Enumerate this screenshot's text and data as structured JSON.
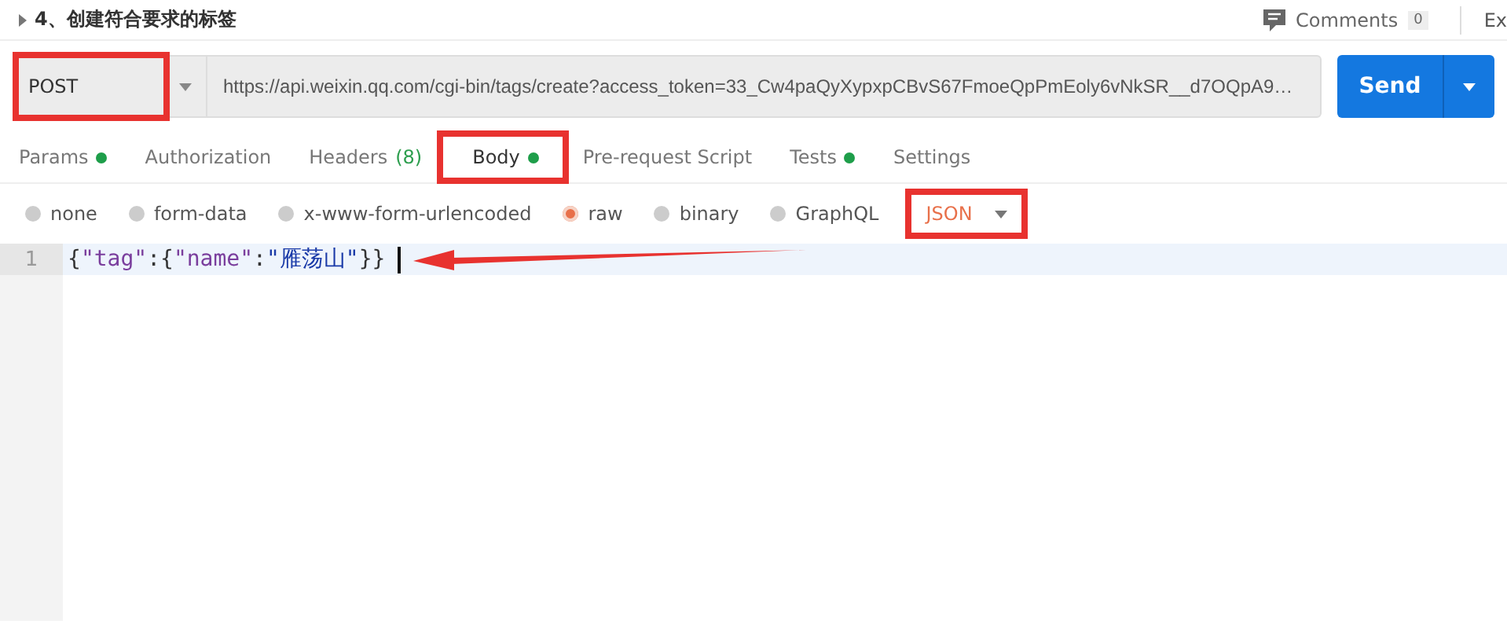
{
  "request": {
    "title": "4、创建符合要求的标签",
    "comments_label": "Comments",
    "comments_count": "0",
    "cut_tab": "Ex"
  },
  "url_bar": {
    "method": "POST",
    "method_highlighted": true,
    "url": "https://api.weixin.qq.com/cgi-bin/tags/create?access_token=33_Cw4paQyXypxpCBvS67FmoeQpPmEoly6vNkSR__d7OQpA9…",
    "send": "Send"
  },
  "tabs": [
    {
      "label": "Params",
      "dot": true,
      "selected": false,
      "highlighted": false
    },
    {
      "label": "Authorization",
      "dot": false,
      "selected": false,
      "highlighted": false
    },
    {
      "label": "Headers",
      "count": "(8)",
      "dot": false,
      "selected": false,
      "highlighted": false
    },
    {
      "label": "Body",
      "dot": true,
      "selected": true,
      "highlighted": true
    },
    {
      "label": "Pre-request Script",
      "dot": false,
      "selected": false,
      "highlighted": false
    },
    {
      "label": "Tests",
      "dot": true,
      "selected": false,
      "highlighted": false
    },
    {
      "label": "Settings",
      "dot": false,
      "selected": false,
      "highlighted": false
    }
  ],
  "body_types": [
    {
      "label": "none",
      "selected": false
    },
    {
      "label": "form-data",
      "selected": false
    },
    {
      "label": "x-www-form-urlencoded",
      "selected": false
    },
    {
      "label": "raw",
      "selected": true
    },
    {
      "label": "binary",
      "selected": false
    },
    {
      "label": "GraphQL",
      "selected": false
    }
  ],
  "format": {
    "label": "JSON",
    "highlighted": true
  },
  "editor": {
    "lines": [
      {
        "number": "1",
        "tokens": [
          {
            "kind": "punct",
            "text": "{"
          },
          {
            "kind": "key",
            "text": "\"tag\""
          },
          {
            "kind": "punct",
            "text": ":{"
          },
          {
            "kind": "key",
            "text": "\"name\""
          },
          {
            "kind": "punct",
            "text": ":"
          },
          {
            "kind": "string",
            "text": "\"雁荡山\""
          },
          {
            "kind": "punct",
            "text": "}}"
          }
        ],
        "arrow": true
      }
    ]
  }
}
